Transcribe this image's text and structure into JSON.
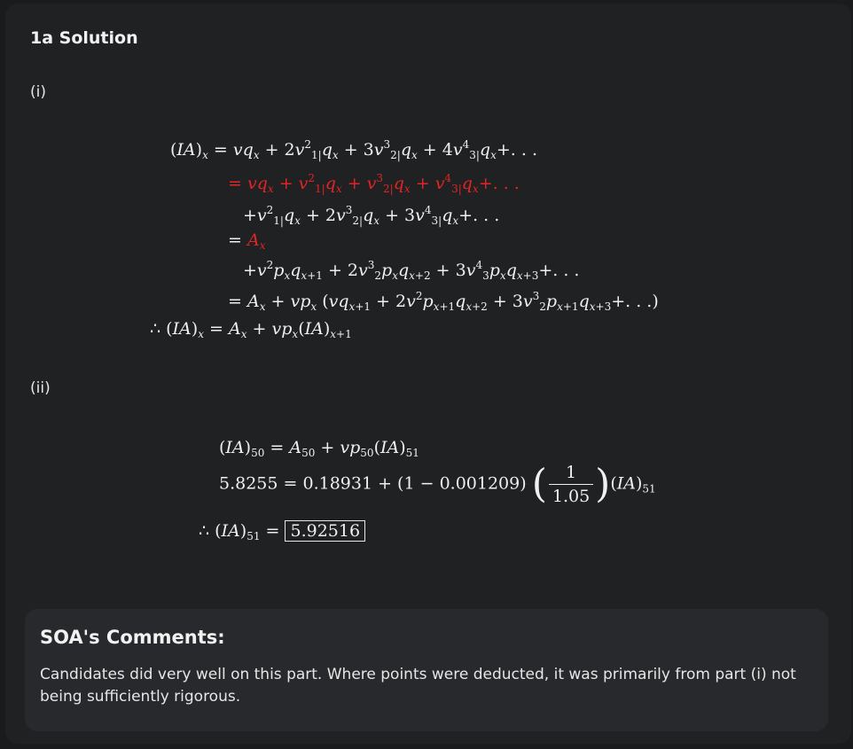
{
  "title": "1a Solution",
  "part_i_label": "(i)",
  "part_ii_label": "(ii)",
  "comments": {
    "heading": "SOA's Comments:",
    "body": "Candidates did very well on this part. Where points were deducted, it was primarily from part (i) not being sufficiently rigorous."
  },
  "solution_ii": {
    "IA50": "5.8255",
    "A50": "0.18931",
    "q50": "0.001209",
    "interest_denominator": "1.05",
    "answer": "5.92516"
  },
  "colors": {
    "highlight": "#e32424",
    "background": "#202123",
    "text": "#f0f0f0"
  }
}
